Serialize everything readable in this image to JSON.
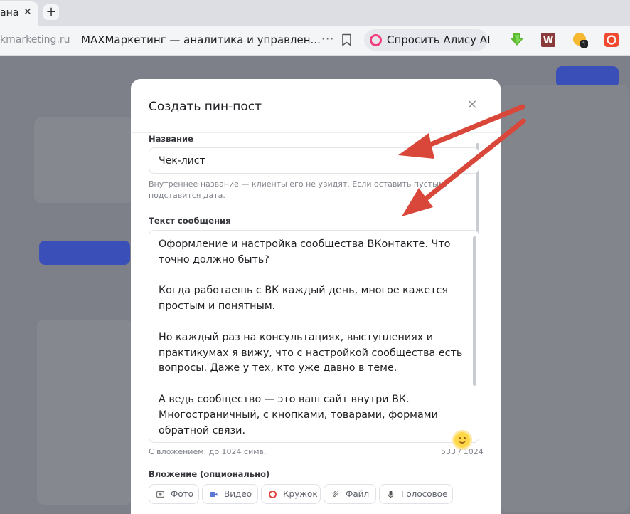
{
  "browser": {
    "tab_title": "ана",
    "tab_close": "✕",
    "new_tab": "+",
    "url_host": "kmarketing.ru",
    "page_title": "MAXМаркетинг — аналитика и управлен...",
    "more": "···",
    "alice_label": "Спросить Алису AI",
    "extension_badge": "1"
  },
  "modal": {
    "title": "Создать пин-пост",
    "close": "×",
    "name_label": "Название",
    "name_value": "Чек-лист",
    "name_hint": "Внутреннее название — клиенты его не увидят. Если оставить пустым, подставится дата.",
    "text_label": "Текст сообщения",
    "text_paragraphs": [
      "Оформление и настройка сообщества ВКонтакте. Что точно должно быть?",
      "Когда работаешь с ВК каждый день, многое кажется простым и понятным.",
      "Но каждый раз на консультациях, выступлениях и практикумах я вижу, что с настройкой сообщества есть вопросы. Даже у тех, кто уже давно в теме.",
      "А ведь сообщество — это ваш сайт внутри ВК. Многостраничный, с кнопками, товарами, формами обратной связи."
    ],
    "limit_hint": "С вложением: до 1024 симв.",
    "char_counter": "533 / 1024",
    "attachment_label": "Вложение (опционально)",
    "attachment_options": [
      "Фото",
      "Видео",
      "Кружок",
      "Файл",
      "Голосовое"
    ]
  },
  "colors": {
    "alice_accent": "#f03f7a",
    "annotation_arrow": "#d9473a",
    "primary_bg_button": "#3b4fb8"
  }
}
